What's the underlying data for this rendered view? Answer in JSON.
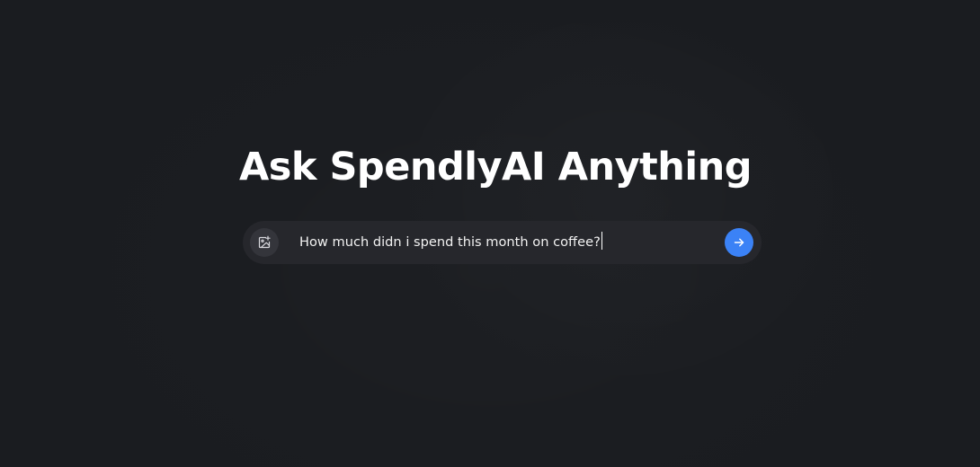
{
  "hero": {
    "title": "Ask SpendlyAI Anything"
  },
  "prompt": {
    "value": "How much didn i spend this month on coffee?",
    "attach_icon": "image-plus-icon",
    "send_icon": "arrow-right-icon"
  },
  "colors": {
    "background": "#1a1c20",
    "bar": "#26272c",
    "attach_button": "#34353b",
    "accent": "#3b82f6",
    "text": "#ffffff"
  }
}
